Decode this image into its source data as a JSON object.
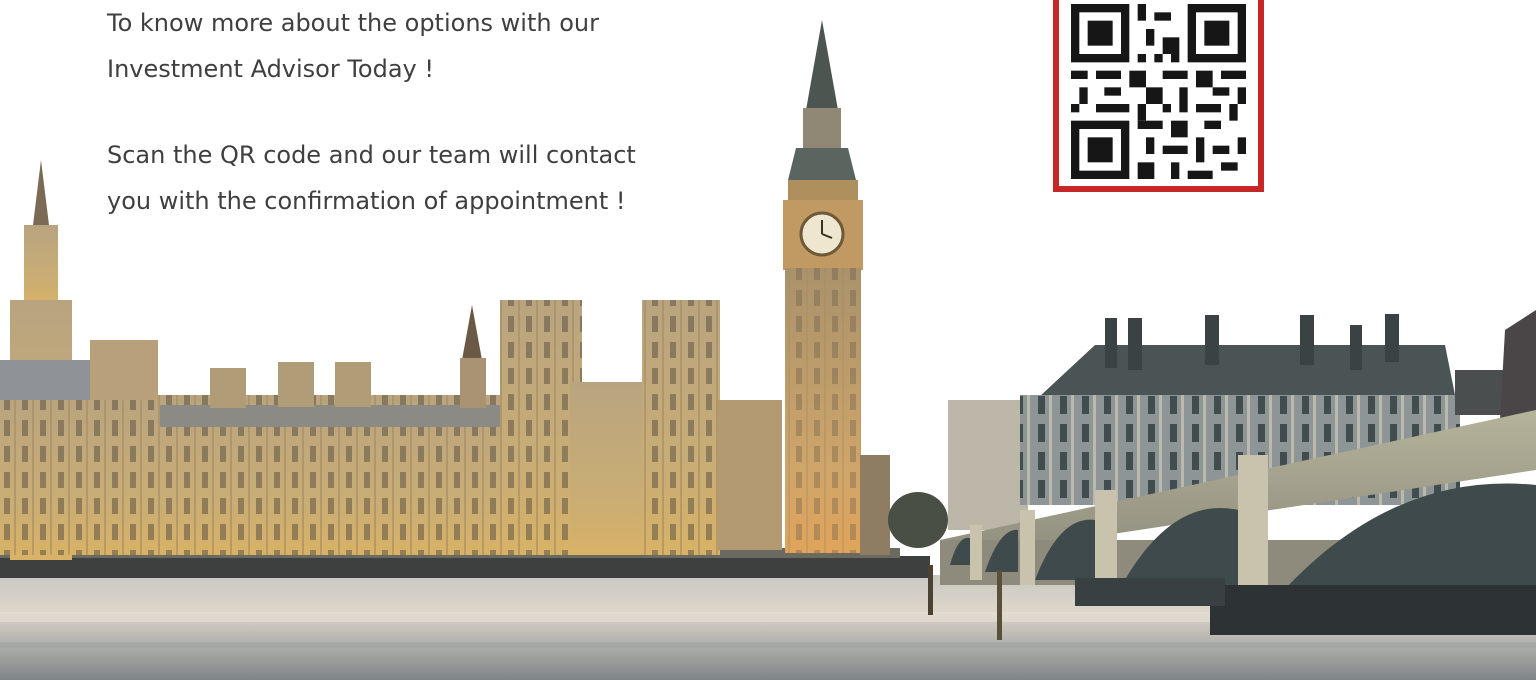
{
  "promo": {
    "paragraph_1": {
      "line_1": "To know more about the options with our",
      "line_2": "Investment Advisor Today !"
    },
    "paragraph_2": {
      "line_1": "Scan the QR code and our team will contact",
      "line_2": "you with the confirmation of appointment !"
    }
  },
  "qr_code": {
    "icon": "qr-code-icon",
    "frame_color": "#c62828"
  },
  "background": {
    "scene": "london-westminster-skyline",
    "sky_color": "#ffffff",
    "river_color": "#d8d2c8",
    "stone_color": "#c8a772"
  }
}
